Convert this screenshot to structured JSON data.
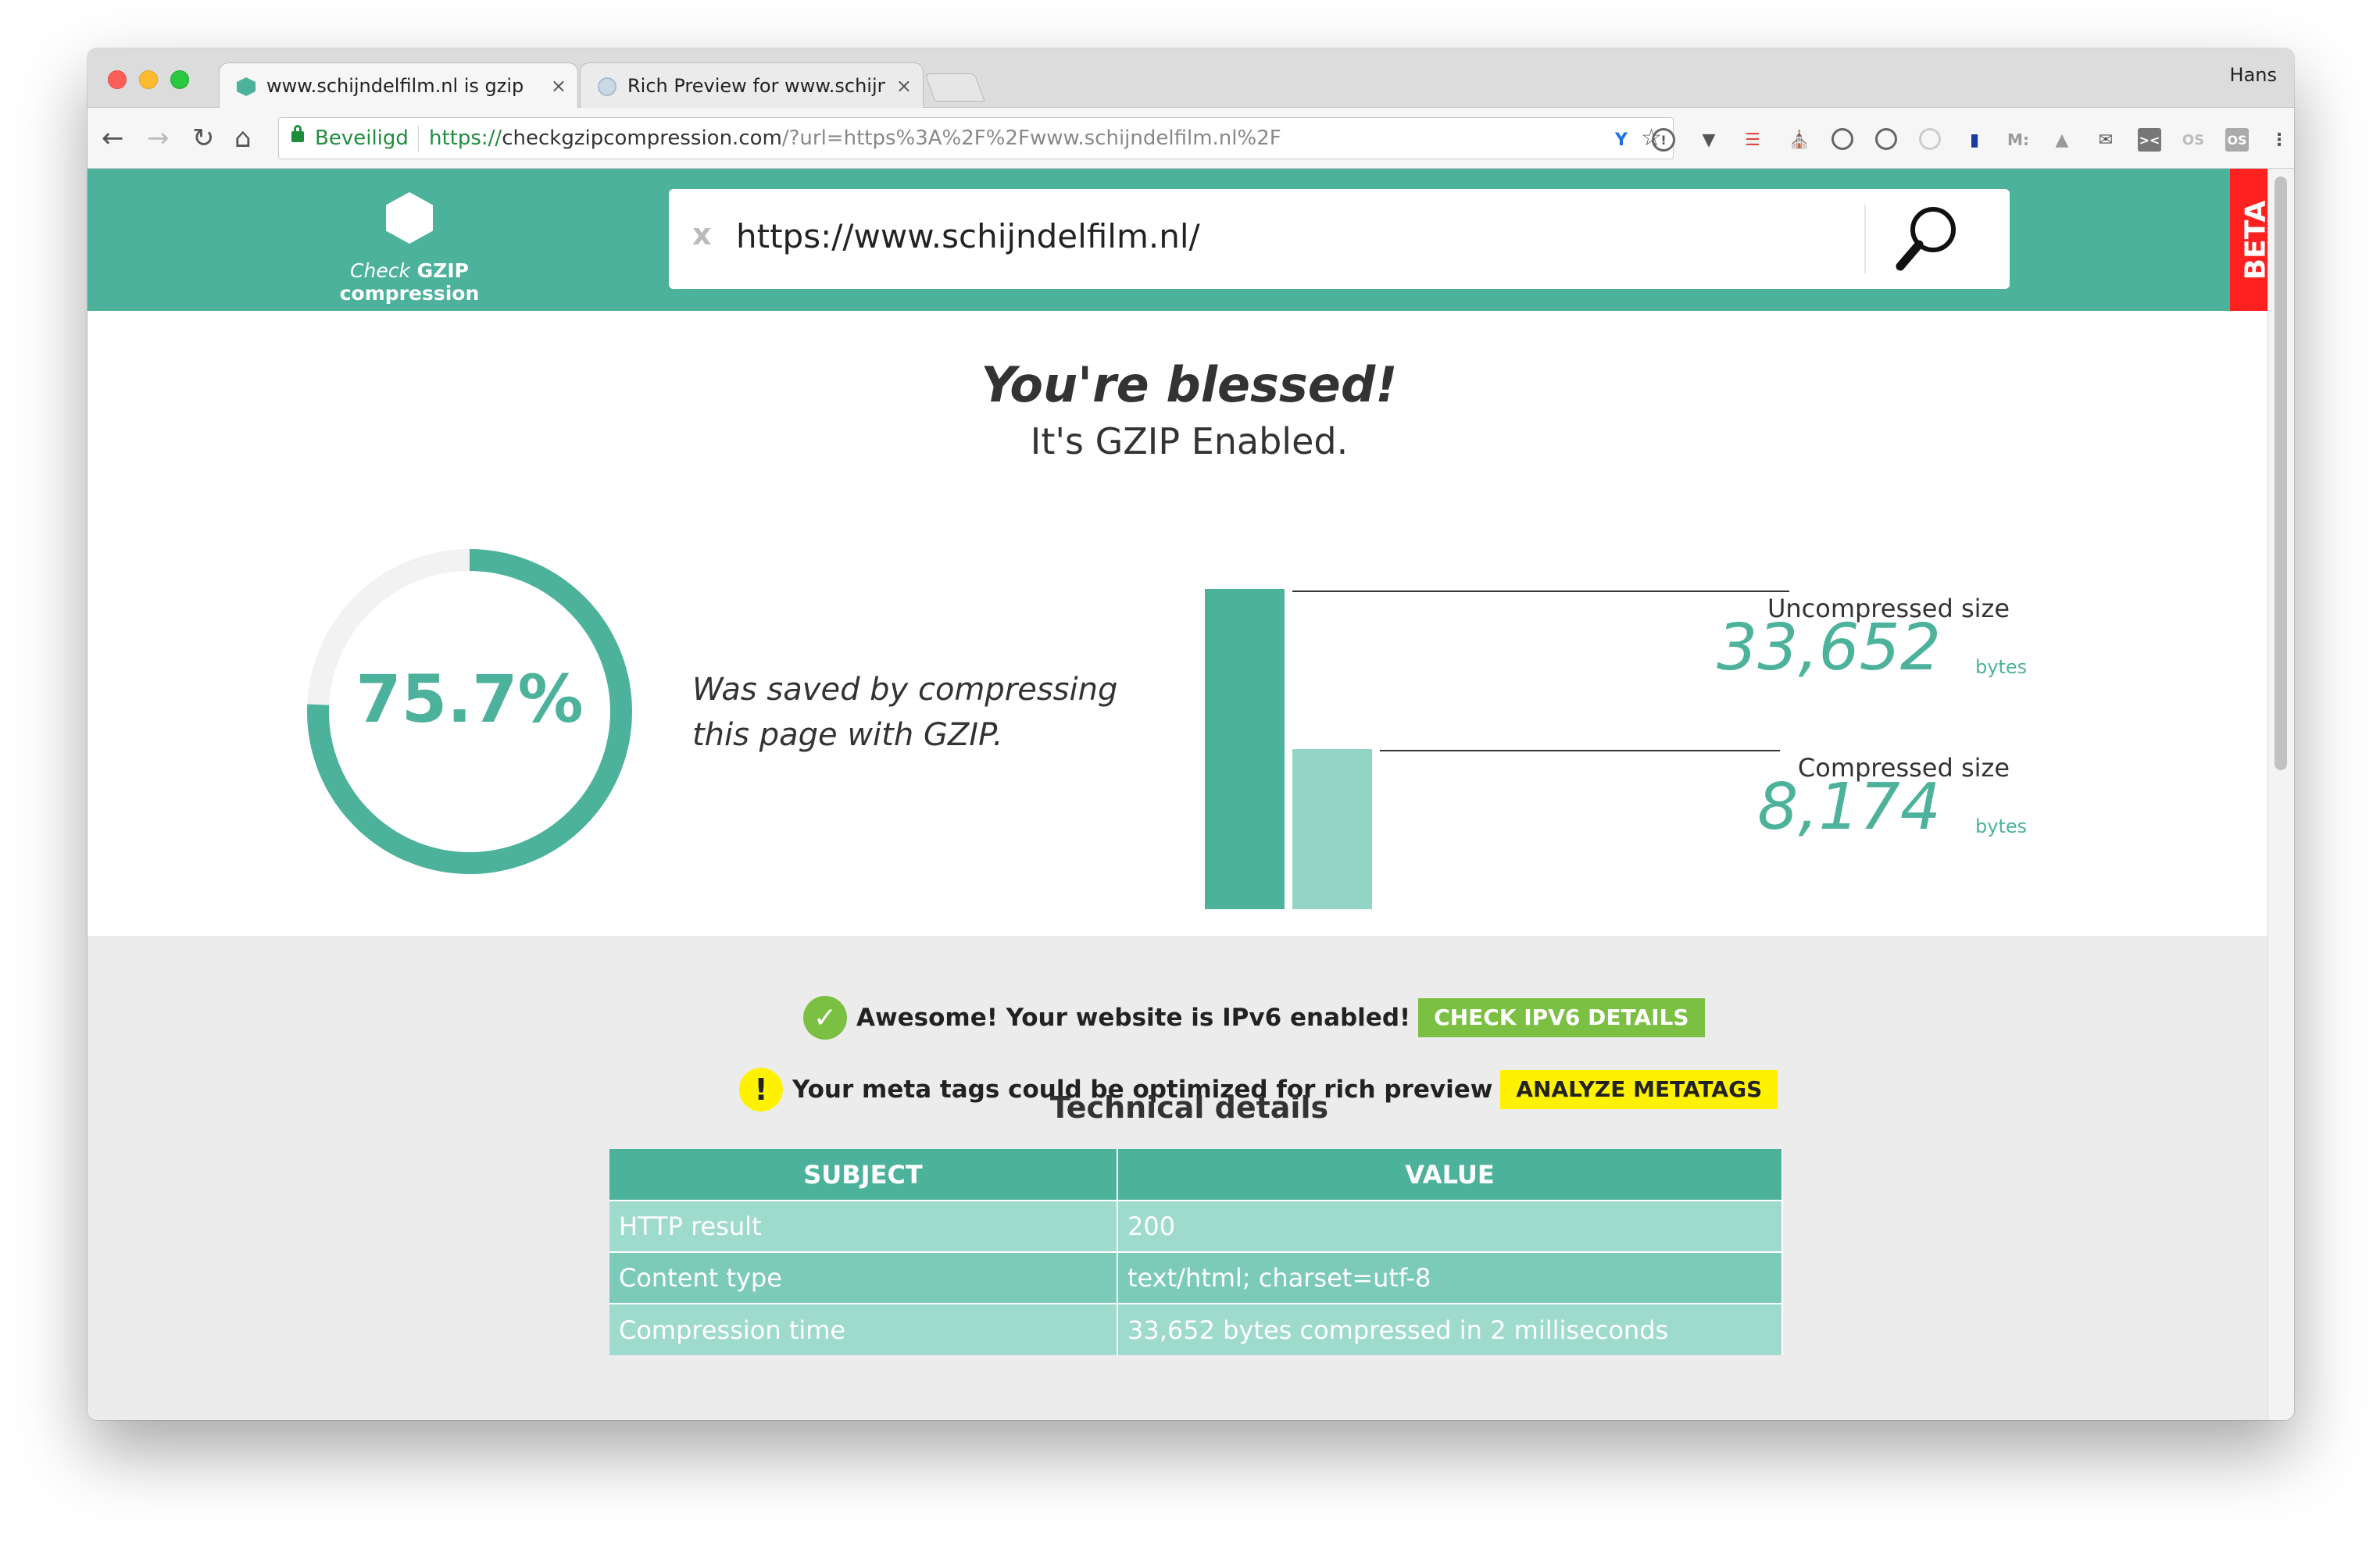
{
  "browser": {
    "profile": "Hans",
    "tabs": [
      {
        "title": "www.schijndelfilm.nl is gzip co",
        "close": "×"
      },
      {
        "title": "Rich Preview for www.schijnde",
        "close": "×"
      }
    ],
    "secure_label": "Beveiligd",
    "url_scheme": "https://",
    "url_host": "checkgzipcompression.com",
    "url_rest": "/?url=https%3A%2F%2Fwww.schijndelfilm.nl%2F"
  },
  "site": {
    "logo_check": "Check",
    "logo_name": "GZIP compression",
    "search_value": "https://www.schijndelfilm.nl/",
    "clear_label": "x",
    "beta": "BETA"
  },
  "result": {
    "title": "You're blessed!",
    "subtitle": "It's GZIP Enabled.",
    "percent_label": "75.7%",
    "percent_value": 75.7,
    "saved_text": "Was saved by compressing this page with GZIP.",
    "uncompressed_label": "Uncompressed size",
    "uncompressed_value": "33,652",
    "compressed_label": "Compressed size",
    "compressed_value": "8,174",
    "unit": "bytes"
  },
  "notices": {
    "ipv6_text": "Awesome! Your website is IPv6 enabled!",
    "ipv6_button": "CHECK IPV6 DETAILS",
    "meta_text": "Your meta tags could be optimized for rich preview",
    "meta_button": "ANALYZE METATAGS"
  },
  "technical": {
    "title": "Technical details",
    "headers": [
      "SUBJECT",
      "VALUE"
    ],
    "rows": [
      [
        "HTTP result",
        "200"
      ],
      [
        "Content type",
        "text/html; charset=utf-8"
      ],
      [
        "Compression time",
        "33,652 bytes compressed in 2 milliseconds"
      ]
    ]
  },
  "colors": {
    "brand": "#4db29b",
    "brand_light": "#93d5c5",
    "success": "#7bc043",
    "warning": "#fff200",
    "beta": "#ff2020"
  }
}
